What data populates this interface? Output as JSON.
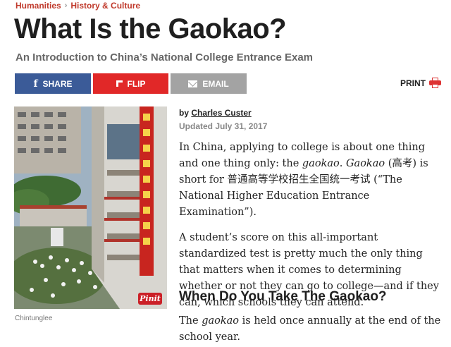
{
  "breadcrumb": {
    "category": "Humanities",
    "separator": "›",
    "subcategory": "History & Culture"
  },
  "title": "What Is the Gaokao?",
  "subtitle": "An Introduction to China’s National College Entrance Exam",
  "share": {
    "facebook": "SHARE",
    "flipboard": "FLIP",
    "email": "EMAIL"
  },
  "print": "PRINT",
  "photo": {
    "credit": "Chintunglee",
    "pin_label": "Pinit",
    "banner_text": "欢迎学子到我校参加高考"
  },
  "byline": {
    "prefix": "by",
    "author": "Charles Custer",
    "updated": "Updated July 31, 2017"
  },
  "article": {
    "p1_a": "In China, applying to college is about one thing and one thing only: the ",
    "p1_term": "gaokao",
    "p1_b": ". ",
    "p1_term2": "Gaokao",
    "p1_c": " (高考) is short for 普通高等学校招生全国统一考试 (“The National Higher Education Entrance Examination”).",
    "p2": "A student’s score on this all-important standardized test is pretty much the only thing that matters when it comes to determining whether or not they can go to college—and if they can, which schools they can attend.",
    "h2": "When Do You Take The Gaokao?",
    "p3_a": "The ",
    "p3_term": "gaokao",
    "p3_b": " is held once annually at the end of the school year."
  },
  "colors": {
    "facebook": "#3b5b98",
    "flipboard": "#e12828",
    "email": "#a3a3a3",
    "accent": "#c0392b"
  },
  "icons": [
    "facebook-icon",
    "flipboard-icon",
    "email-icon",
    "printer-icon",
    "pinterest-icon"
  ]
}
